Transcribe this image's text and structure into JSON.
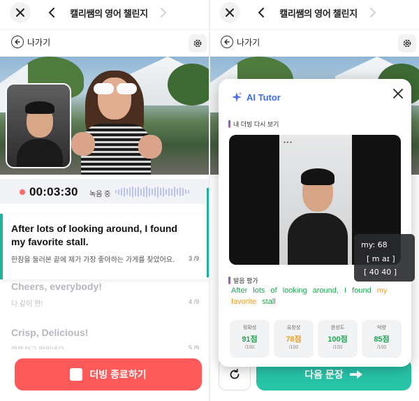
{
  "header": {
    "title": "캘리쌤의 영어 챌린지",
    "back_label": "나가기"
  },
  "recording": {
    "time": "00:03:30",
    "status": "녹음 중"
  },
  "sentences": [
    {
      "en": "After lots of looking around, I found my favorite stall.",
      "ko": "한참을 둘러본 끝에 제가 가장 좋아하는 가게를 찾았어요.",
      "num": "3 /9"
    },
    {
      "en": "Cheers, everybody!",
      "ko": "다 같이 짠!",
      "num": "4 /9"
    },
    {
      "en": "Crisp, Delicious!",
      "ko": "깍뚝하고 맛있네요",
      "num": "5 /9"
    }
  ],
  "end_button": "더빙 종료하기",
  "tutor": {
    "title": "AI Tutor",
    "replay_label": "내 더빙 다시 보기",
    "eval_label": "발음 평가",
    "tooltip": {
      "line1": "my: 68",
      "line2": "[ m    aɪ ]",
      "line3": "[ 40   40 ]"
    },
    "sentence_words": [
      {
        "w": "After",
        "c": "ok"
      },
      {
        "w": "lots",
        "c": "ok"
      },
      {
        "w": "of",
        "c": "ok"
      },
      {
        "w": "looking",
        "c": "ok"
      },
      {
        "w": "around,",
        "c": "ok"
      },
      {
        "w": "I",
        "c": "ok"
      },
      {
        "w": "found",
        "c": "ok"
      },
      {
        "w": "my",
        "c": "mid"
      },
      {
        "w": "favorite",
        "c": "mid"
      },
      {
        "w": "stall",
        "c": "ok"
      }
    ],
    "scores": [
      {
        "label": "정확성",
        "value": "91점",
        "denom": "/100",
        "color": "#22a654"
      },
      {
        "label": "유창성",
        "value": "78점",
        "denom": "/100",
        "color": "#f0a020"
      },
      {
        "label": "완성도",
        "value": "100점",
        "denom": "/100",
        "color": "#22a654"
      },
      {
        "label": "억양",
        "value": "85점",
        "denom": "/100",
        "color": "#22a654"
      }
    ]
  },
  "next_button": "다음 문장"
}
